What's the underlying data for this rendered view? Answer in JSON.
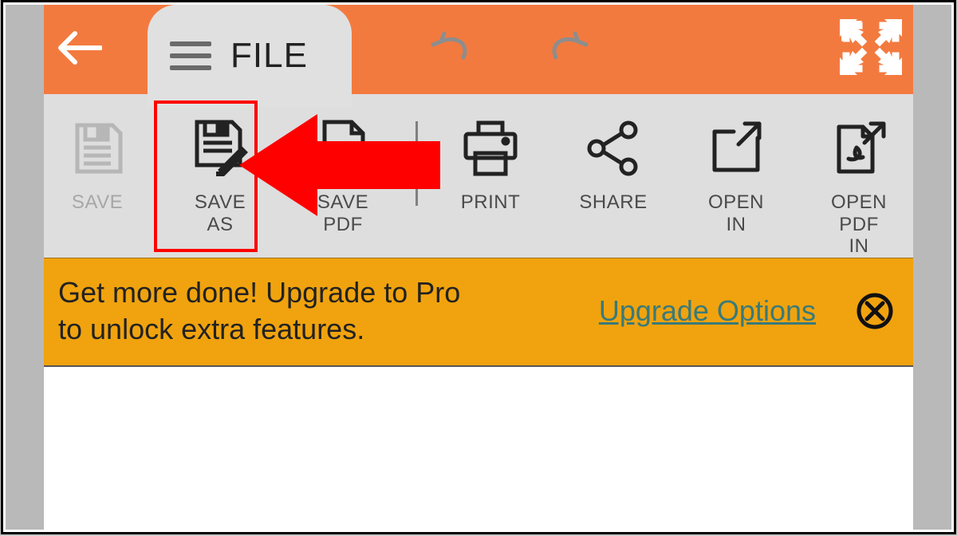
{
  "header": {
    "tab_label": "FILE"
  },
  "toolbar": {
    "items": [
      {
        "label": "SAVE"
      },
      {
        "label": "SAVE\nAS"
      },
      {
        "label": "SAVE\nPDF"
      },
      {
        "label": "PRINT"
      },
      {
        "label": "SHARE"
      },
      {
        "label": "OPEN\nIN"
      },
      {
        "label": "OPEN\nPDF\nIN"
      }
    ]
  },
  "banner": {
    "text": "Get more done! Upgrade to Pro to unlock extra features.",
    "link_label": "Upgrade Options"
  }
}
